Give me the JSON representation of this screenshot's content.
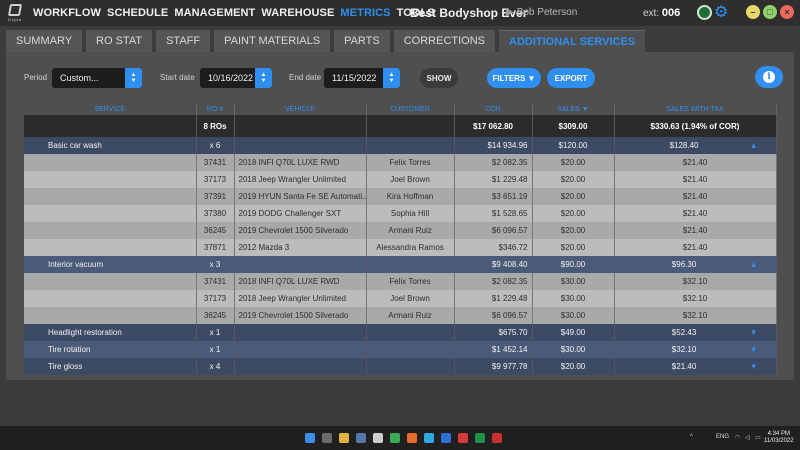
{
  "app": {
    "logo_text": "Ezyka",
    "nav": [
      "WORKFLOW",
      "SCHEDULE",
      "MANAGEMENT",
      "WAREHOUSE",
      "METRICS",
      "TOOLS"
    ],
    "active_nav": "METRICS",
    "shop_name": "Best Bodyshop Ever",
    "user_name": "Bob Peterson",
    "ext_label": "ext:",
    "ext_value": "006",
    "accent": "#2f8ff0"
  },
  "tabs": [
    "SUMMARY",
    "RO STAT",
    "STAFF",
    "PAINT MATERIALS",
    "PARTS",
    "CORRECTIONS",
    "ADDITIONAL SERVICES"
  ],
  "active_tab": "ADDITIONAL SERVICES",
  "filters": {
    "period_label": "Period",
    "period_value": "Custom...",
    "start_label": "Start date",
    "start_value": "10/16/2022",
    "end_label": "End date",
    "end_value": "11/15/2022",
    "show": "SHOW",
    "filters_btn": "FILTERS",
    "export_btn": "EXPORT"
  },
  "table": {
    "headers": [
      "SERVICE",
      "RO #",
      "VEHICLE",
      "CUSTOMER",
      "COR",
      "SALES",
      "SALES WITH TAX"
    ],
    "total": {
      "ro": "8 ROs",
      "cor": "$17 062.80",
      "sales": "$309.00",
      "sales_tax": "$330.63  (1.94% of COR)"
    },
    "groups": [
      {
        "service": "Basic car wash",
        "count": "x 6",
        "cor": "$14 934.96",
        "sales": "$120.00",
        "sales_tax": "$128.40",
        "expanded": true,
        "rows": [
          {
            "ro": "37431",
            "vehicle": "2018 INFI Q70L LUXE RWD",
            "customer": "Felix Torres",
            "cor": "$2 082.35",
            "sales": "$20.00",
            "sales_tax": "$21.40"
          },
          {
            "ro": "37173",
            "vehicle": "2018 Jeep Wrangler Unlimited",
            "customer": "Joel Brown",
            "cor": "$1 229.48",
            "sales": "$20.00",
            "sales_tax": "$21.40"
          },
          {
            "ro": "37391",
            "vehicle": "2019 HYUN Santa Fe SE Automati...",
            "customer": "Kira Hoffman",
            "cor": "$3 651.19",
            "sales": "$20.00",
            "sales_tax": "$21.40"
          },
          {
            "ro": "37380",
            "vehicle": "2019 DODG Challenger SXT",
            "customer": "Sophia Hill",
            "cor": "$1 528.65",
            "sales": "$20.00",
            "sales_tax": "$21.40"
          },
          {
            "ro": "36245",
            "vehicle": "2019 Chevrolet 1500 Silverado",
            "customer": "Armani Ruiz",
            "cor": "$6 096.57",
            "sales": "$20.00",
            "sales_tax": "$21.40"
          },
          {
            "ro": "37871",
            "vehicle": "2012 Mazda 3",
            "customer": "Alessandra Ramos",
            "cor": "$346.72",
            "sales": "$20.00",
            "sales_tax": "$21.40"
          }
        ]
      },
      {
        "service": "Interior vacuum",
        "count": "x 3",
        "cor": "$9 408.40",
        "sales": "$90.00",
        "sales_tax": "$96.30",
        "expanded": true,
        "rows": [
          {
            "ro": "37431",
            "vehicle": "2018 INFI Q70L LUXE RWD",
            "customer": "Felix Torres",
            "cor": "$2 082.35",
            "sales": "$30.00",
            "sales_tax": "$32.10"
          },
          {
            "ro": "37173",
            "vehicle": "2018 Jeep Wrangler Unlimited",
            "customer": "Joel Brown",
            "cor": "$1 229.48",
            "sales": "$30.00",
            "sales_tax": "$32.10"
          },
          {
            "ro": "36245",
            "vehicle": "2019 Chevrolet 1500 Silverado",
            "customer": "Armani Ruiz",
            "cor": "$6 096.57",
            "sales": "$30.00",
            "sales_tax": "$32.10"
          }
        ]
      },
      {
        "service": "Headlight restoration",
        "count": "x 1",
        "cor": "$675.70",
        "sales": "$49.00",
        "sales_tax": "$52.43",
        "expanded": false,
        "rows": []
      },
      {
        "service": "Tire rotation",
        "count": "x 1",
        "cor": "$1 452.14",
        "sales": "$30.00",
        "sales_tax": "$32.10",
        "expanded": false,
        "rows": []
      },
      {
        "service": "Tire gloss",
        "count": "x 4",
        "cor": "$9 977.78",
        "sales": "$20.00",
        "sales_tax": "$21.40",
        "expanded": false,
        "rows": []
      }
    ]
  },
  "taskbar": {
    "lang": "ENG",
    "time": "4:34 PM",
    "date": "11/03/2022"
  }
}
